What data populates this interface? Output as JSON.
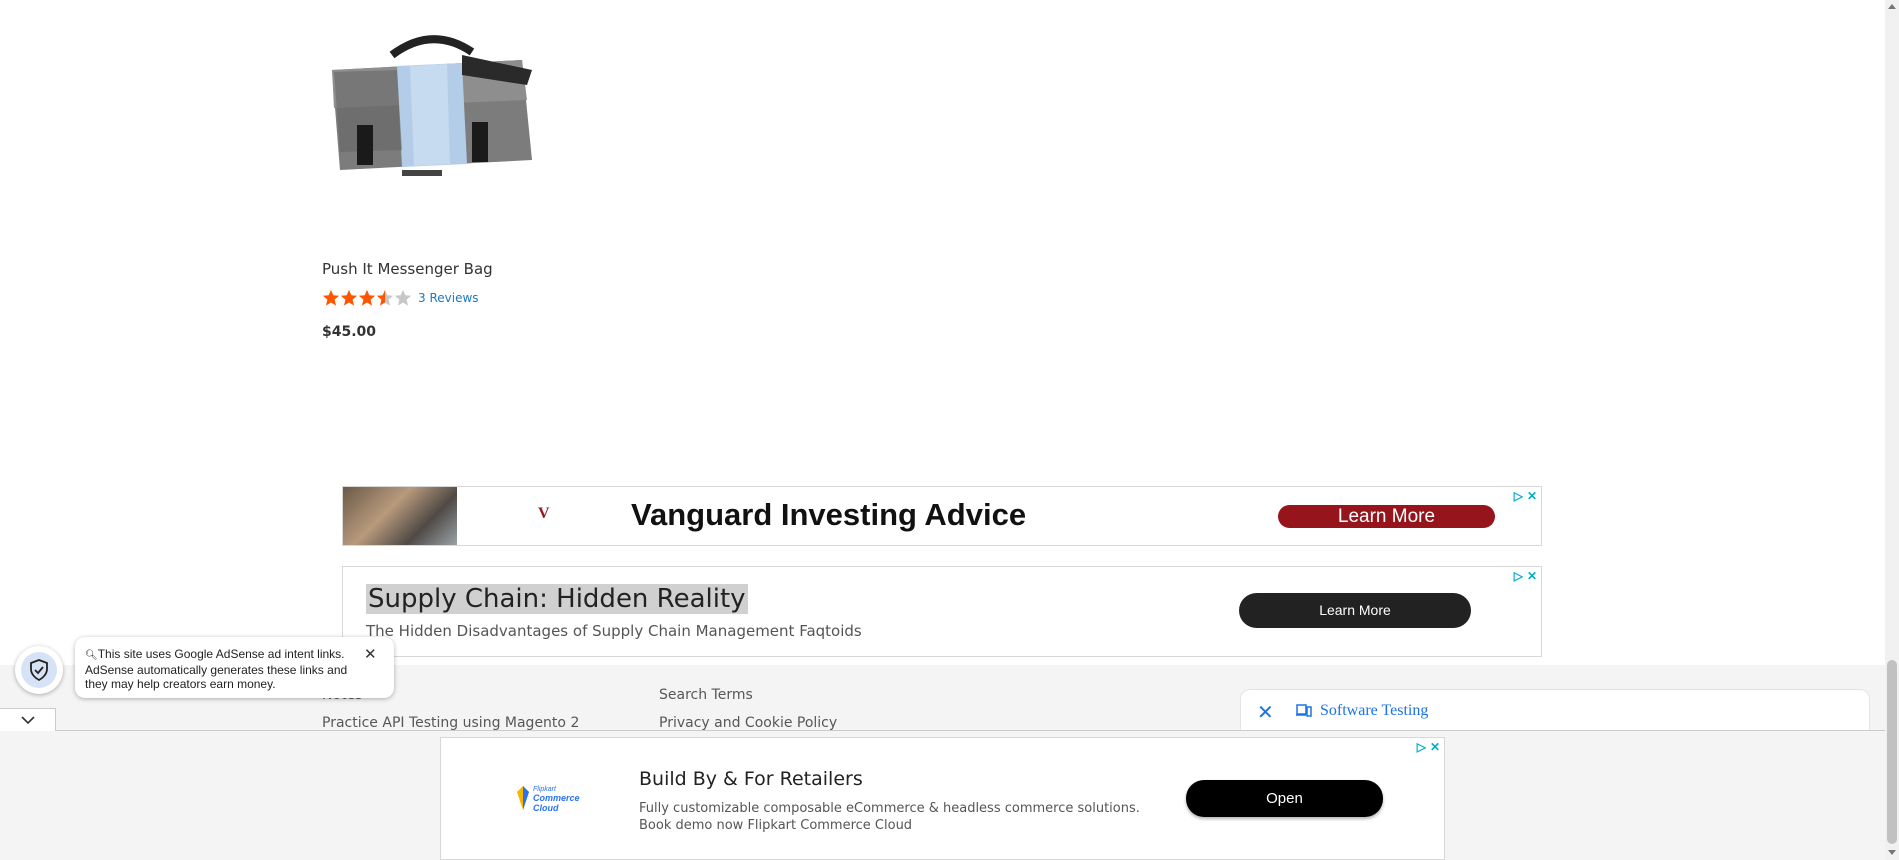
{
  "product": {
    "name": "Push It Messenger Bag",
    "rating_fraction": 0.6,
    "stars_filled": 3,
    "reviews_label": "3 Reviews",
    "price": "$45.00"
  },
  "ad_top": {
    "brand_mark": "V",
    "headline": "Vanguard Investing Advice",
    "cta": "Learn More",
    "colors": {
      "brand": "#96151d"
    }
  },
  "ad_middle": {
    "headline": "Supply Chain: Hidden Reality",
    "description": "The Hidden Disadvantages of Supply Chain Management Faqtoids",
    "cta": "Learn More"
  },
  "footer": {
    "col1": [
      "Notes",
      "Practice API Testing using Magento 2"
    ],
    "col2": [
      "Search Terms",
      "Privacy and Cookie Policy"
    ],
    "search_panel": {
      "label": "Software Testing",
      "icon": "search-results-icon"
    }
  },
  "adsense_notice": {
    "text": "This site uses Google AdSense ad intent links. AdSense automatically generates these links and they may help creators earn money.",
    "icon": "shield-check-icon"
  },
  "ad_anchor": {
    "logo_text_1": "Flipkart",
    "logo_text_2": "Commerce",
    "logo_text_3": "Cloud",
    "headline": "Build By & For Retailers",
    "description": "Fully customizable composable eCommerce & headless commerce solutions. Book demo now Flipkart Commerce Cloud",
    "cta": "Open"
  },
  "colors": {
    "link": "#1979c3",
    "star": "#ff5501",
    "adchoices": "#00aecd"
  }
}
